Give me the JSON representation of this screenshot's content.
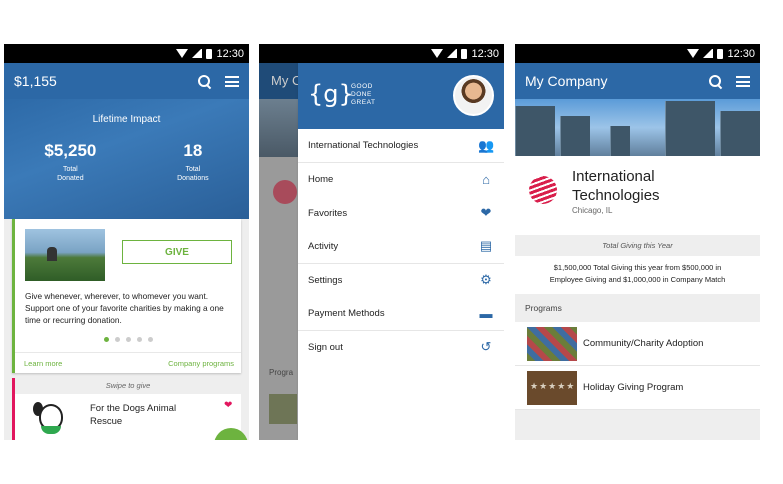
{
  "status_time": "12:30",
  "screen1": {
    "balance": "$1,155",
    "impact_label": "Lifetime Impact",
    "stats": [
      {
        "value": "$5,250",
        "label_line1": "Total",
        "label_line2": "Donated"
      },
      {
        "value": "18",
        "label_line1": "Total",
        "label_line2": "Donations"
      }
    ],
    "give_label": "GIVE",
    "description": "Give whenever, wherever, to whomever you want. Support one of your favorite charities by making a one time or recurring donation.",
    "carousel_total": 5,
    "carousel_active": 1,
    "learn_more": "Learn more",
    "company_programs": "Company programs",
    "swipe_label": "Swipe to give",
    "charity_name": "For the Dogs Animal Rescue"
  },
  "screen2": {
    "background_title": "My C",
    "background_programs": "Progra",
    "logo_g": "{g}",
    "logo_text": [
      "GOOD",
      "DONE",
      "GREAT"
    ],
    "company": "International Technologies",
    "items": [
      {
        "label": "Home",
        "icon": "home-icon"
      },
      {
        "label": "Favorites",
        "icon": "heart-icon"
      },
      {
        "label": "Activity",
        "icon": "document-icon"
      },
      {
        "label": "Settings",
        "icon": "gear-icon"
      },
      {
        "label": "Payment Methods",
        "icon": "credit-card-icon"
      },
      {
        "label": "Sign out",
        "icon": "sign-out-icon"
      }
    ]
  },
  "screen3": {
    "title": "My Company",
    "org_name_line1": "International",
    "org_name_line2": "Technologies",
    "org_location": "Chicago, IL",
    "total_giving_label": "Total Giving this Year",
    "total_giving_line1": "$1,500,000 Total Giving this year from $500,000 in",
    "total_giving_line2": "Employee Giving and $1,000,000 in Company Match",
    "programs_label": "Programs",
    "programs": [
      {
        "name": "Community/Charity Adoption"
      },
      {
        "name": "Holiday Giving Program"
      }
    ]
  },
  "colors": {
    "primary": "#2c68a6",
    "accent_green": "#6db33f",
    "accent_pink": "#e2165e"
  }
}
